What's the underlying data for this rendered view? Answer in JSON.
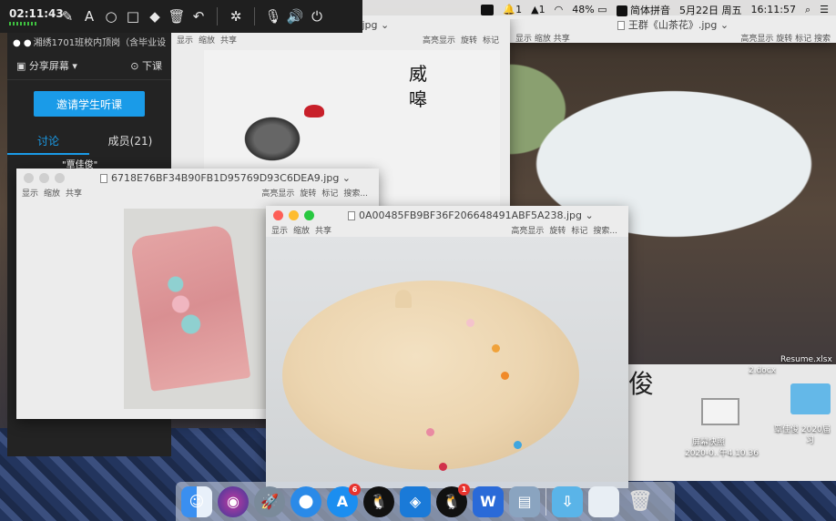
{
  "menubar": {
    "items": [
      "1",
      "1",
      "48%",
      "简体拼音",
      "5月22日 周五",
      "16:11:57"
    ]
  },
  "anno_toolbar": {
    "time": "02:11:43"
  },
  "class_panel": {
    "title": "湘绣1701班校内顶岗（含毕业设",
    "share_label": "分享屏幕",
    "end_label": "下课",
    "invite_label": "邀请学生听课",
    "tab_discuss": "讨论",
    "tab_members": "成员(21)",
    "member_name": "\"覃佳俊\""
  },
  "win_a": {
    "title_suffix": "》.jpg",
    "toolbar_left": [
      "显示",
      "缩放",
      "共享"
    ],
    "toolbar_right": [
      "高亮显示",
      "旋转",
      "标记"
    ],
    "calligraphy": "威\n嗥"
  },
  "win_b": {
    "title": "王群《山茶花》.jpg",
    "toolbar_left": [
      "显示",
      "缩放",
      "共享"
    ],
    "toolbar_right": [
      "高亮显示",
      "旋转",
      "标记",
      "搜索"
    ]
  },
  "win_c": {
    "title": "6718E76BF34B90FB1D95769D93C6DEA9.jpg",
    "toolbar_left": [
      "显示",
      "缩放",
      "共享"
    ],
    "toolbar_right": [
      "高亮显示",
      "旋转",
      "标记",
      "搜索..."
    ]
  },
  "win_d": {
    "title": "0A00485FB9BF36F206648491ABF5A238.jpg",
    "toolbar_left": [
      "显示",
      "缩放",
      "共享"
    ],
    "toolbar_right": [
      "高亮显示",
      "旋转",
      "标记",
      "搜索..."
    ]
  },
  "finder": {
    "big_text": "俊",
    "file_docx": "2.docx",
    "file_resume": "Resume.xlsx",
    "screenshot_label_1": "屏幕快照",
    "screenshot_label_2": "2020-0..午4.10.36",
    "folder_label_1": "覃佳俊 2020届",
    "folder_label_2": "习"
  },
  "dock": {
    "badge_appstore": "6",
    "badge_qq": "1"
  }
}
